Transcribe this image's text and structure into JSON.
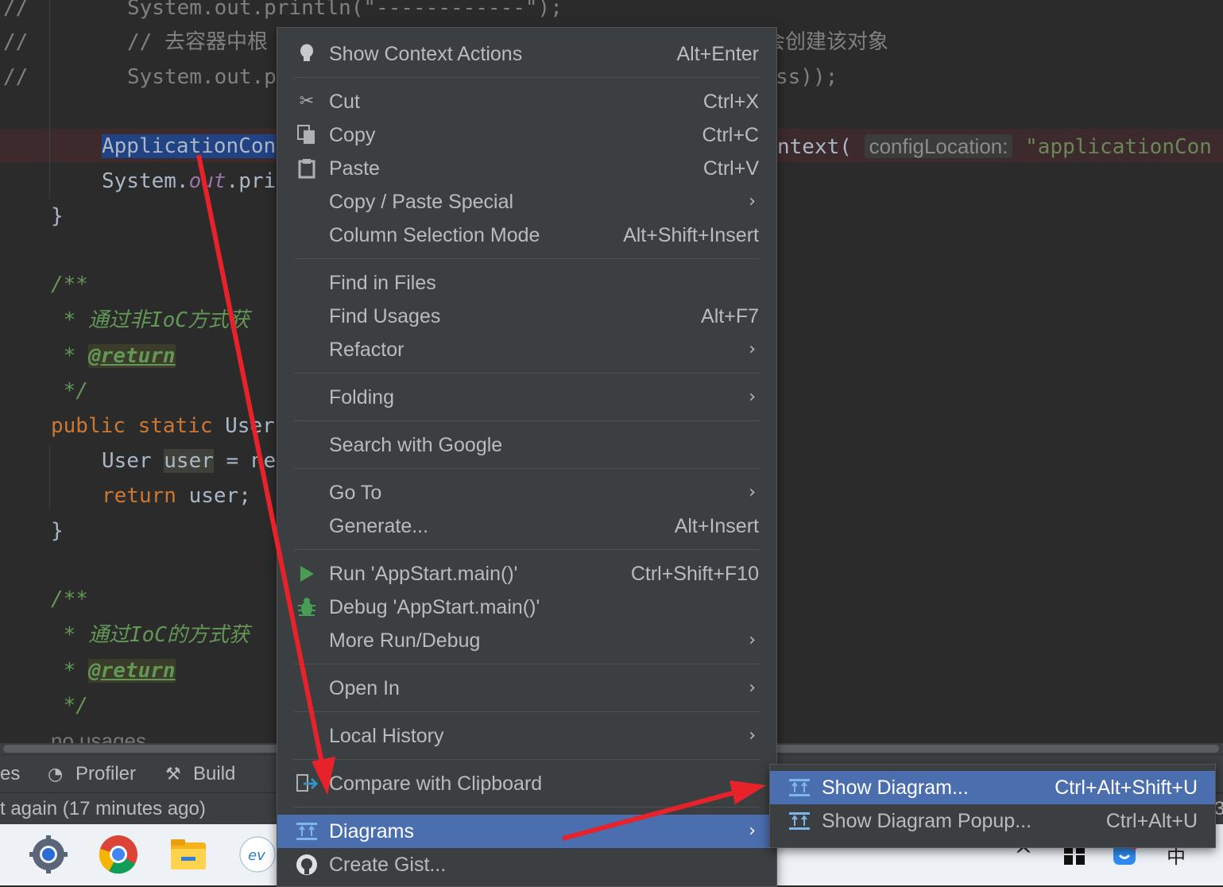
{
  "editor": {
    "lines": {
      "l1": "System.out.println(\"------------\");",
      "l2a": "// 去容器中根",
      "l2b": "会创建该对象",
      "l3a": "System.out.p",
      "l3b": "ss));",
      "l4a": "ApplicationCon",
      "l4b": "ntext(",
      "l4hint": "configLocation:",
      "l4c": "\"applicationCon",
      "l5a": "System.",
      "l5b": "out",
      "l5c": ".pri",
      "brace1": "}",
      "doc1_open": "/**",
      "doc1_text": " * 通过非IoC方式获",
      "doc1_star": " * ",
      "doc1_tag": "@return",
      "doc1_close": " */",
      "m_public": "public static ",
      "m_type": "User",
      "u_type": "User ",
      "u_var": "user",
      "u_rest": " = ne",
      "ret_kw": "return ",
      "ret_rest": "user;",
      "brace2": "}",
      "doc2_open": "/**",
      "doc2_text": " * 通过IoC的方式获",
      "doc2_star": " * ",
      "doc2_tag": "@return",
      "doc2_close": " */",
      "usages": "no usages"
    },
    "comment_prefix": "//"
  },
  "toolbar": {
    "partial": "es",
    "profiler": "Profiler",
    "build": "Build"
  },
  "statusbar": {
    "text": "t again (17 minutes ago)",
    "right_partial": "3"
  },
  "context_menu": {
    "items": [
      {
        "label": "Show Context Actions",
        "shortcut": "Alt+Enter",
        "icon": "lightbulb-icon"
      },
      {
        "label": "Cut",
        "shortcut": "Ctrl+X",
        "icon": "scissors-icon"
      },
      {
        "label": "Copy",
        "shortcut": "Ctrl+C",
        "icon": "copy-icon"
      },
      {
        "label": "Paste",
        "shortcut": "Ctrl+V",
        "icon": "paste-icon"
      },
      {
        "label": "Copy / Paste Special",
        "shortcut": "",
        "icon": ""
      },
      {
        "label": "Column Selection Mode",
        "shortcut": "Alt+Shift+Insert",
        "icon": ""
      },
      {
        "label": "Find in Files",
        "shortcut": "",
        "icon": ""
      },
      {
        "label": "Find Usages",
        "shortcut": "Alt+F7",
        "icon": ""
      },
      {
        "label": "Refactor",
        "shortcut": "",
        "icon": ""
      },
      {
        "label": "Folding",
        "shortcut": "",
        "icon": ""
      },
      {
        "label": "Search with Google",
        "shortcut": "",
        "icon": ""
      },
      {
        "label": "Go To",
        "shortcut": "",
        "icon": ""
      },
      {
        "label": "Generate...",
        "shortcut": "Alt+Insert",
        "icon": ""
      },
      {
        "label": "Run 'AppStart.main()'",
        "shortcut": "Ctrl+Shift+F10",
        "icon": "run-icon"
      },
      {
        "label": "Debug 'AppStart.main()'",
        "shortcut": "",
        "icon": "debug-icon"
      },
      {
        "label": "More Run/Debug",
        "shortcut": "",
        "icon": ""
      },
      {
        "label": "Open In",
        "shortcut": "",
        "icon": ""
      },
      {
        "label": "Local History",
        "shortcut": "",
        "icon": ""
      },
      {
        "label": "Compare with Clipboard",
        "shortcut": "",
        "icon": "compare-icon"
      },
      {
        "label": "Diagrams",
        "shortcut": "",
        "icon": "diagram-icon"
      },
      {
        "label": "Create Gist...",
        "shortcut": "",
        "icon": "github-icon"
      }
    ],
    "submenu_arrow": "›"
  },
  "submenu": {
    "items": [
      {
        "label": "Show Diagram...",
        "shortcut": "Ctrl+Alt+Shift+U"
      },
      {
        "label": "Show Diagram Popup...",
        "shortcut": "Ctrl+Alt+U"
      }
    ]
  },
  "taskbar": {
    "caret": "^",
    "ime": "中"
  },
  "colors": {
    "editor_bg": "#2b2b2b",
    "menu_bg": "#3c3f41",
    "selection": "#4b6eaf",
    "annotation_arrow": "#e8222a"
  }
}
